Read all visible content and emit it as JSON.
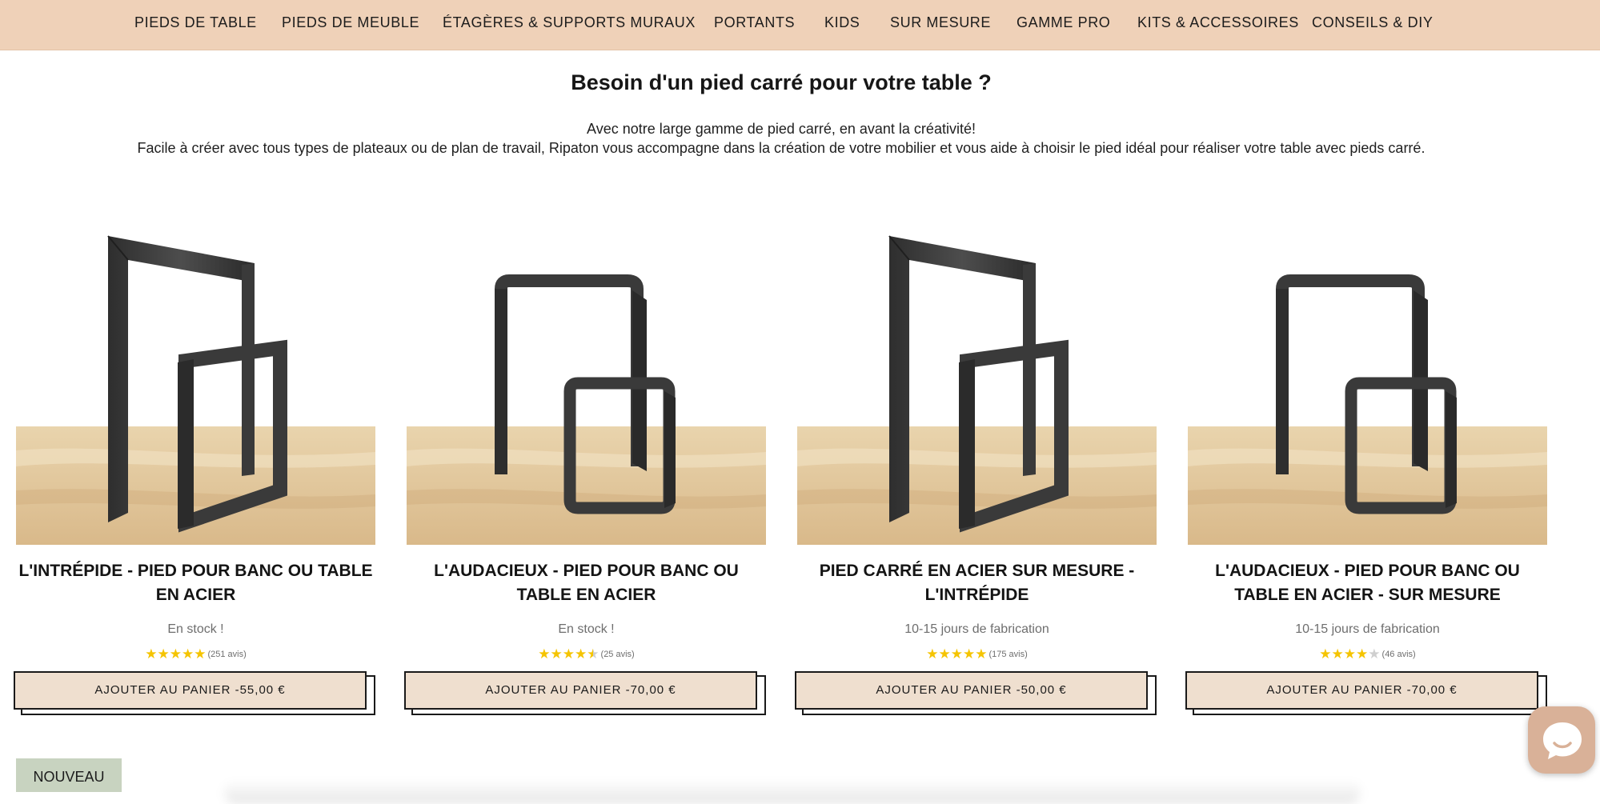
{
  "nav": {
    "items": [
      "PIEDS DE TABLE",
      "PIEDS DE MEUBLE",
      "ÉTAGÈRES & SUPPORTS MURAUX",
      "PORTANTS",
      "KIDS",
      "SUR MESURE",
      "GAMME PRO",
      "KITS & ACCESSOIRES",
      "CONSEILS & DIY"
    ]
  },
  "headline": "Besoin d'un pied carré pour votre table ?",
  "intro": {
    "line1": "Avec notre large gamme de pied carré, en avant la créativité!",
    "line2": "Facile à créer avec tous types de plateaux ou de plan de travail, Ripaton vous accompagne dans la création de votre mobilier et vous aide à choisir le pied idéal pour réaliser votre table avec pieds carré."
  },
  "products": [
    {
      "title": "L'intrépide - Pied pour banc ou table en acier",
      "availability": "En stock !",
      "rating": 5,
      "reviews": "(251 avis)",
      "button": "AJOUTER AU PANIER -55,00 €",
      "image_style": "angled"
    },
    {
      "title": "L'audacieux - Pied pour banc ou table en acier",
      "availability": "En stock !",
      "rating": 4.5,
      "reviews": "(25 avis)",
      "button": "AJOUTER AU PANIER -70,00 €",
      "image_style": "rounded"
    },
    {
      "title": "Pied carré en acier sur mesure - L'intrépide",
      "availability": "10-15 jours de fabrication",
      "rating": 5,
      "reviews": "(175 avis)",
      "button": "AJOUTER AU PANIER -50,00 €",
      "image_style": "angled"
    },
    {
      "title": "L'audacieux - Pied pour banc ou table en acier - Sur mesure",
      "availability": "10-15 jours de fabrication",
      "rating": 4,
      "reviews": "(46 avis)",
      "button": "AJOUTER AU PANIER -70,00 €",
      "image_style": "rounded"
    }
  ],
  "badge": "NOUVEAU",
  "colors": {
    "nav_bg": "#efd1b8",
    "button_bg": "#efdfcf",
    "star": "#f5c400",
    "badge_bg": "#c8d3c0",
    "chat_bg": "#d9b198"
  },
  "icons": {
    "chat": "chat-bubble-icon",
    "star": "star-icon"
  }
}
